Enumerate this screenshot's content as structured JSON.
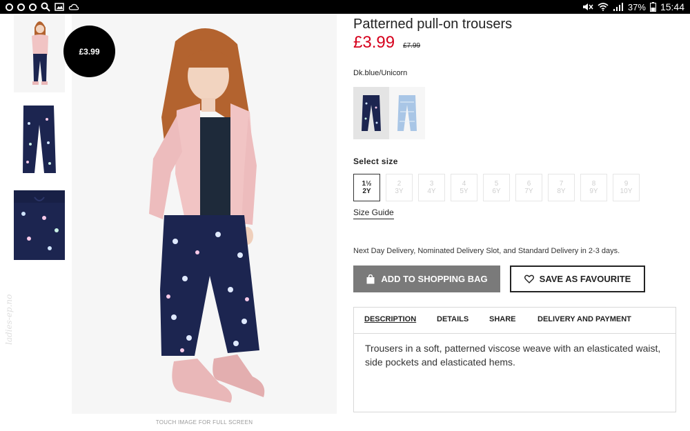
{
  "status_bar": {
    "battery": "37%",
    "time": "15:44"
  },
  "product": {
    "title": "Patterned pull-on trousers",
    "price_now": "£3.99",
    "price_old": "£7.99",
    "badge_price": "£3.99",
    "colour_name": "Dk.blue/Unicorn",
    "touch_note": "TOUCH IMAGE FOR FULL SCREEN",
    "watermark": "ladies-ep.no"
  },
  "size_select": {
    "label": "Select size",
    "sizes": [
      {
        "top": "1½",
        "bottom": "2Y",
        "selected": true
      },
      {
        "top": "2",
        "bottom": "3Y",
        "selected": false
      },
      {
        "top": "3",
        "bottom": "4Y",
        "selected": false
      },
      {
        "top": "4",
        "bottom": "5Y",
        "selected": false
      },
      {
        "top": "5",
        "bottom": "6Y",
        "selected": false
      },
      {
        "top": "6",
        "bottom": "7Y",
        "selected": false
      },
      {
        "top": "7",
        "bottom": "8Y",
        "selected": false
      },
      {
        "top": "8",
        "bottom": "9Y",
        "selected": false
      },
      {
        "top": "9",
        "bottom": "10Y",
        "selected": false
      }
    ],
    "size_guide": "Size Guide"
  },
  "delivery_note": "Next Day Delivery, Nominated Delivery Slot, and Standard Delivery in 2-3 days.",
  "actions": {
    "add_to_bag": "ADD TO SHOPPING BAG",
    "save_favourite": "SAVE AS FAVOURITE"
  },
  "tabs": [
    "DESCRIPTION",
    "DETAILS",
    "SHARE",
    "DELIVERY AND PAYMENT"
  ],
  "description": "Trousers in a soft, patterned viscose weave with an elasticated waist, side pockets and elasticated hems.",
  "colors": {
    "price_red": "#d6001c",
    "button_grey": "#7a7a7a",
    "navy": "#1c2550",
    "jacket_pink": "#f1c4c4"
  }
}
